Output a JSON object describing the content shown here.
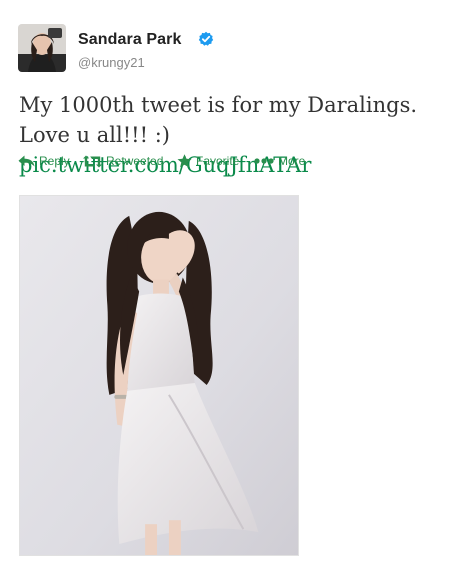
{
  "user": {
    "display_name": "Sandara Park",
    "handle": "@krungy21",
    "avatar_icon": "profile-photo",
    "verified_icon": "verified-badge-icon"
  },
  "tweet": {
    "text": "My 1000th tweet is for my Daralings. Love u all!!! :) ",
    "link": "pic.twitter.com/GuqJfnATAr"
  },
  "actions": {
    "reply": "Reply",
    "retweeted": "Retweeted",
    "favorite": "Favorite",
    "more": "More"
  },
  "colors": {
    "link": "#0a8a4a",
    "action": "#2a8f4e",
    "verified": "#1d9bf0"
  },
  "photo": {
    "description_icon": "tweet-photo"
  }
}
